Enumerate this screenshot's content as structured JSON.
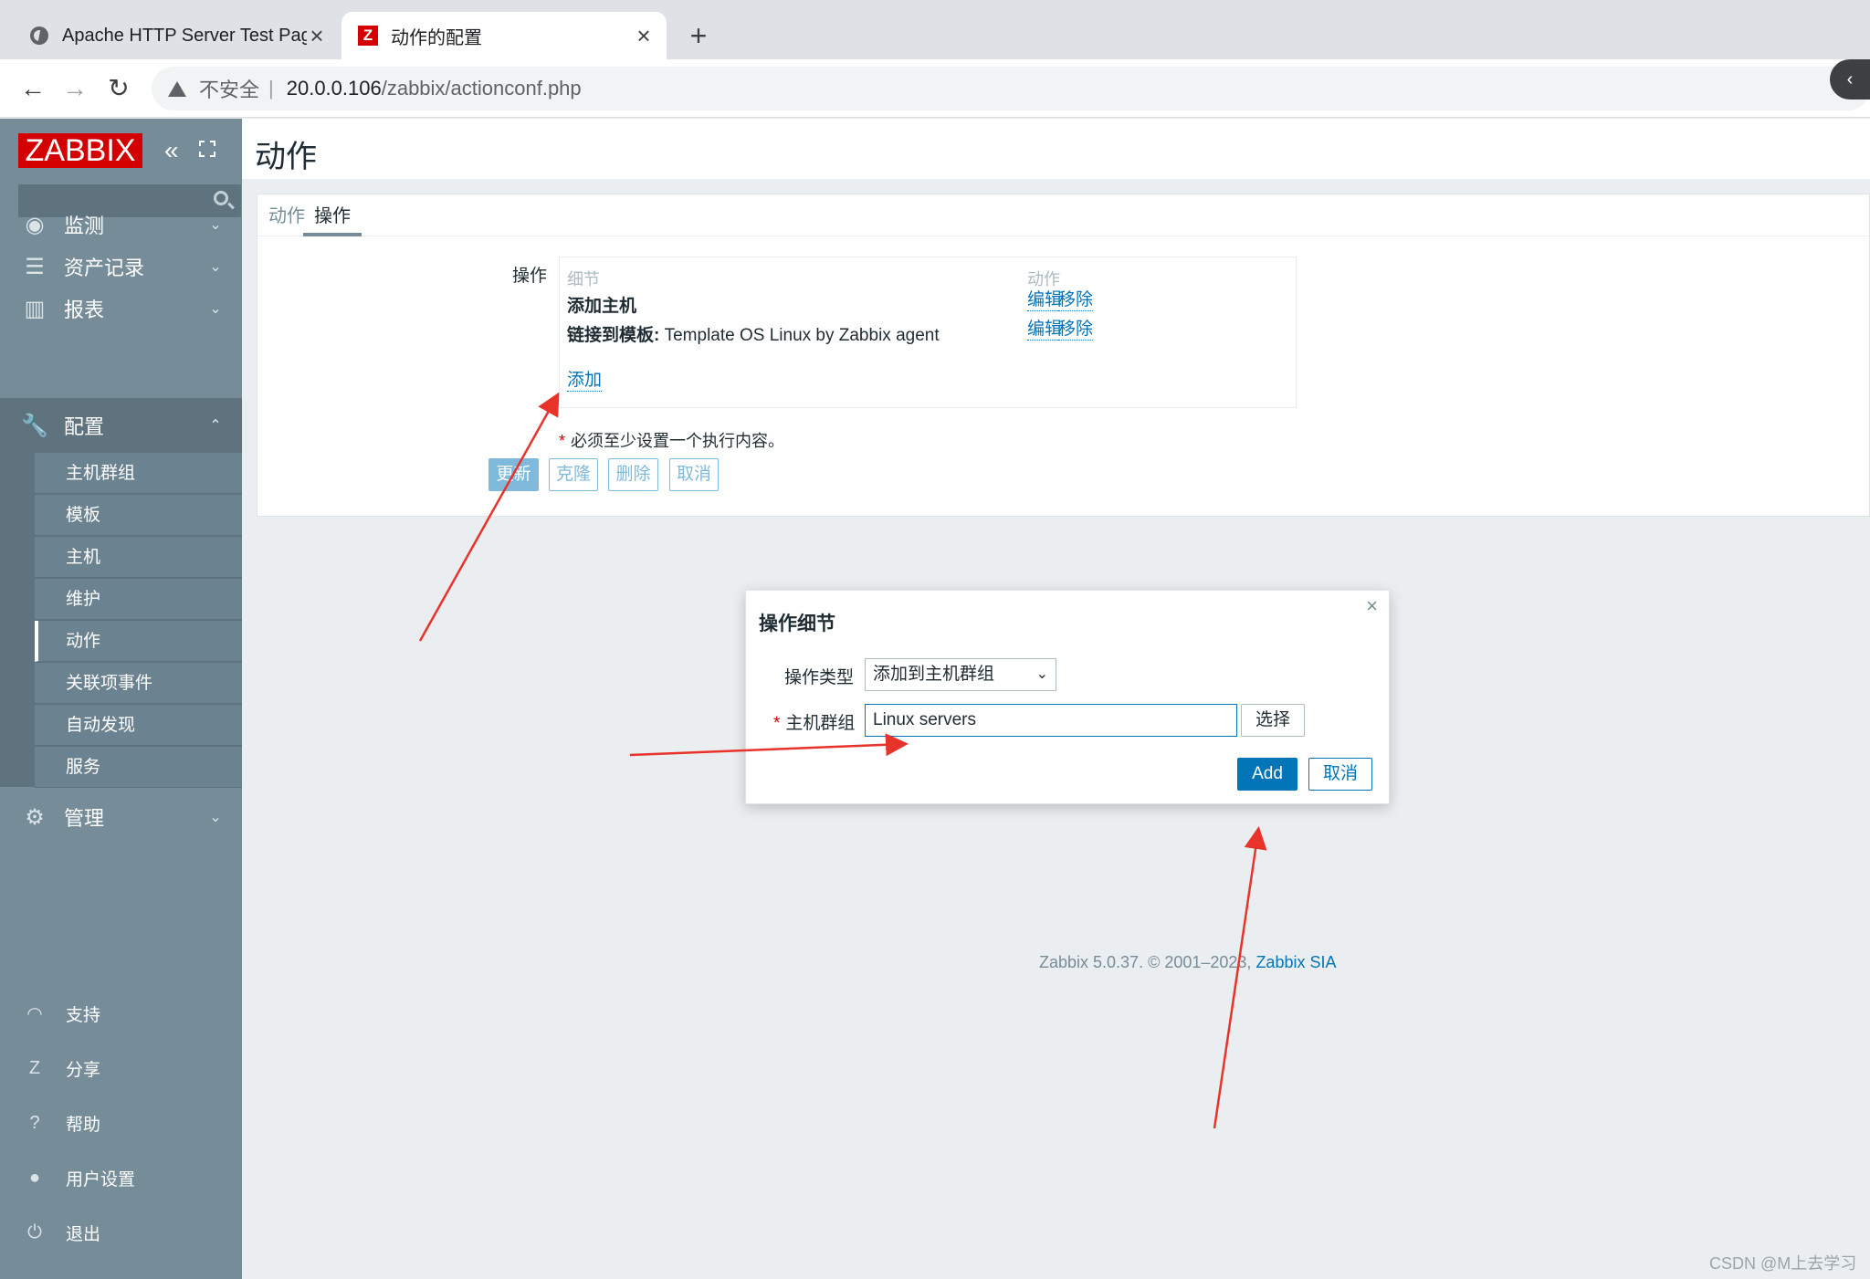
{
  "browser": {
    "tabs": [
      {
        "title": "Apache HTTP Server Test Page",
        "icon": "globe-icon",
        "active": false
      },
      {
        "title": "动作的配置",
        "icon": "zabbix-favicon",
        "active": true
      }
    ],
    "new_tab": "+",
    "insecure_label": "不安全",
    "url_host": "20.0.0.106",
    "url_path": "/zabbix/actionconf.php"
  },
  "sidebar": {
    "logo": "ZABBIX",
    "search_placeholder": "",
    "menu": [
      {
        "label": "监测",
        "icon": "eye-icon"
      },
      {
        "label": "资产记录",
        "icon": "list-icon"
      },
      {
        "label": "报表",
        "icon": "chart-icon"
      },
      {
        "label": "配置",
        "icon": "wrench-icon",
        "open": true
      },
      {
        "label": "管理",
        "icon": "gear-icon"
      }
    ],
    "submenu": [
      {
        "label": "主机群组"
      },
      {
        "label": "模板"
      },
      {
        "label": "主机"
      },
      {
        "label": "维护"
      },
      {
        "label": "动作",
        "selected": true
      },
      {
        "label": "关联项事件"
      },
      {
        "label": "自动发现"
      },
      {
        "label": "服务"
      }
    ],
    "bottom": [
      {
        "label": "支持",
        "icon": "headset-icon"
      },
      {
        "label": "分享",
        "icon": "zabbix-share-icon"
      },
      {
        "label": "帮助",
        "icon": "help-icon"
      },
      {
        "label": "用户设置",
        "icon": "user-icon"
      },
      {
        "label": "退出",
        "icon": "power-icon"
      }
    ]
  },
  "page": {
    "title": "动作",
    "tabs": [
      {
        "label": "动作"
      },
      {
        "label": "操作",
        "active": true
      }
    ],
    "operations_label": "操作",
    "table": {
      "col_details": "细节",
      "col_action": "动作",
      "rows": [
        {
          "bold": "添加主机",
          "text": "",
          "edit": "编辑",
          "remove": "移除"
        },
        {
          "bold": "链接到模板:",
          "text": " Template OS Linux by Zabbix agent",
          "edit": "编辑",
          "remove": "移除"
        }
      ],
      "add": "添加"
    },
    "required_note": "必须至少设置一个执行内容。",
    "buttons": {
      "update": "更新",
      "clone": "克隆",
      "delete": "删除",
      "cancel": "取消"
    },
    "footer_text": "Zabbix 5.0.37. © 2001–2023, ",
    "footer_link": "Zabbix SIA",
    "watermark": "CSDN @M上去学习"
  },
  "modal": {
    "title": "操作细节",
    "close": "×",
    "op_type_label": "操作类型",
    "op_type_value": "添加到主机群组",
    "host_group_label": "主机群组",
    "host_group_value": "Linux servers",
    "select_button": "选择",
    "add_button": "Add",
    "cancel_button": "取消"
  },
  "colors": {
    "sidebar_bg": "#768d99",
    "zabbix_red": "#d40000",
    "link_blue": "#0275b8",
    "annotation_arrow": "#e8332a"
  }
}
